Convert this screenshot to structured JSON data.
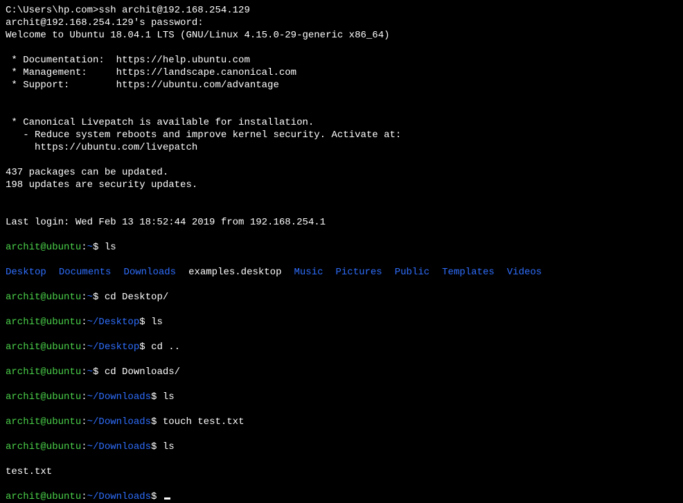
{
  "ssh_cmd": "C:\\Users\\hp.com>ssh archit@192.168.254.129",
  "pw_prompt": "archit@192.168.254.129's password:",
  "welcome": "Welcome to Ubuntu 18.04.1 LTS (GNU/Linux 4.15.0-29-generic x86_64)",
  "doc_line": " * Documentation:  https://help.ubuntu.com",
  "mgmt_line": " * Management:     https://landscape.canonical.com",
  "sup_line": " * Support:        https://ubuntu.com/advantage",
  "livepatch1": " * Canonical Livepatch is available for installation.",
  "livepatch2": "   - Reduce system reboots and improve kernel security. Activate at:",
  "livepatch3": "     https://ubuntu.com/livepatch",
  "pkg1": "437 packages can be updated.",
  "pkg2": "198 updates are security updates.",
  "lastlogin": "Last login: Wed Feb 13 18:52:44 2019 from 192.168.254.1",
  "prompt_user": "archit@ubuntu",
  "colon": ":",
  "tilde": "~",
  "tilde_desktop": "~/Desktop",
  "tilde_downloads": "~/Downloads",
  "dollar": "$ ",
  "cmd_ls": "ls",
  "cmd_cd_desktop": "cd Desktop/",
  "cmd_cd_up": "cd ..",
  "cmd_cd_downloads": "cd Downloads/",
  "cmd_touch": "touch test.txt",
  "ls_home": {
    "d0": "Desktop",
    "d1": "Documents",
    "d2": "Downloads",
    "f0": "examples.desktop",
    "d3": "Music",
    "d4": "Pictures",
    "d5": "Public",
    "d6": "Templates",
    "d7": "Videos"
  },
  "testfile": "test.txt"
}
